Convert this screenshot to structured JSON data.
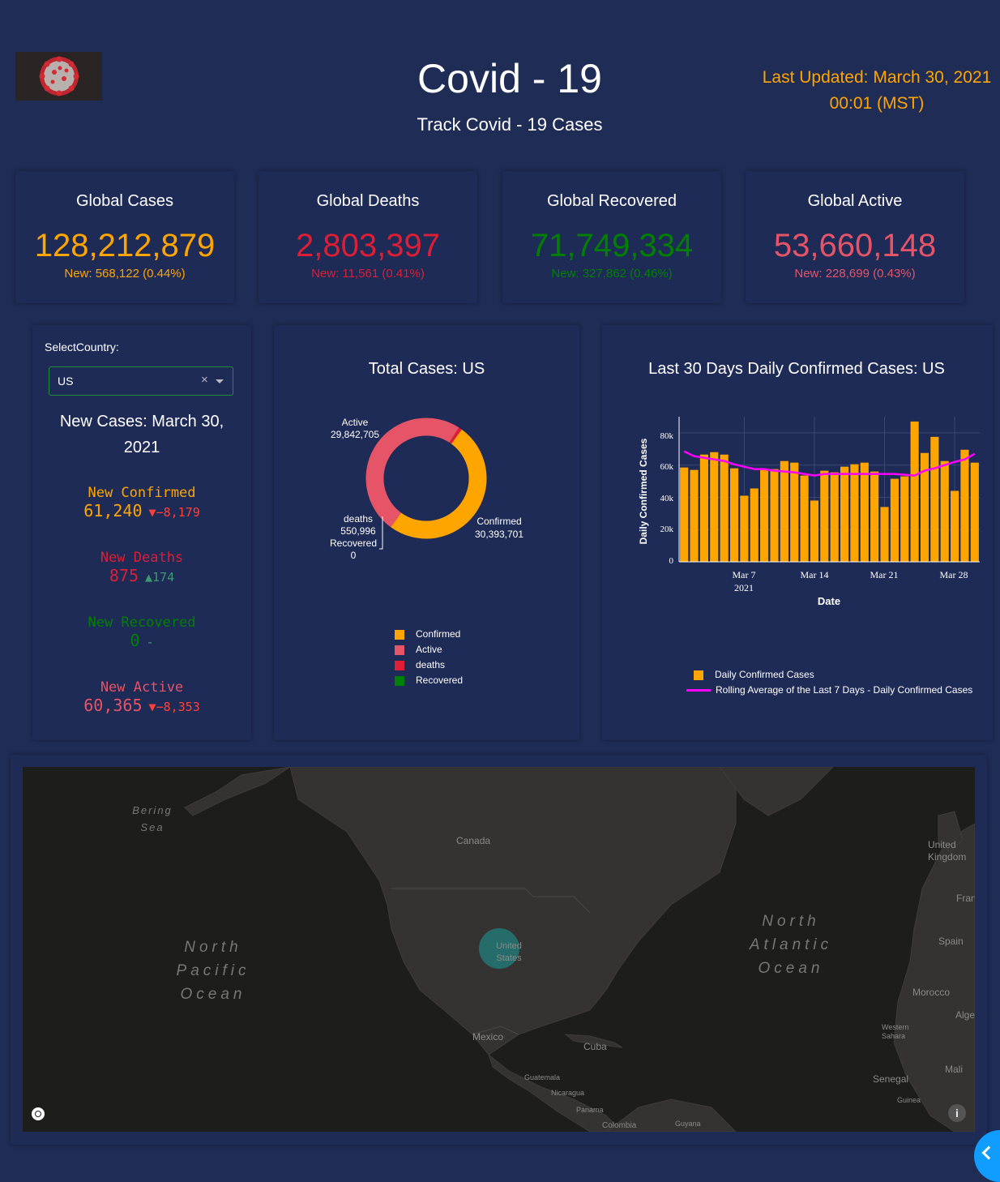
{
  "header": {
    "title": "Covid - 19",
    "subtitle": "Track Covid - 19 Cases",
    "last_updated_line1": "Last Updated: March 30, 2021",
    "last_updated_line2": "00:01 (MST)",
    "logo_icon": "coronavirus-logo-icon"
  },
  "kpis": [
    {
      "title": "Global Cases",
      "value": "128,212,879",
      "new": "New: 568,122 (0.44%)",
      "color": "#ffa500"
    },
    {
      "title": "Global Deaths",
      "value": "2,803,397",
      "new": "New: 11,561 (0.41%)",
      "color": "#dd1e35"
    },
    {
      "title": "Global Recovered",
      "value": "71,749,334",
      "new": "New: 327,862 (0.46%)",
      "color": "#008000"
    },
    {
      "title": "Global Active",
      "value": "53,660,148",
      "new": "New: 228,699 (0.43%)",
      "color": "#e55467"
    }
  ],
  "selector": {
    "label": "SelectCountry:",
    "value": "US",
    "clear_icon": "clear-icon",
    "dropdown_icon": "chevron-down-icon",
    "new_cases_title": "New Cases: March 30, 2021"
  },
  "indicators": [
    {
      "label": "New Confirmed",
      "value": "61,240",
      "delta": "▼−8,179",
      "color": "#ffa500",
      "delta_color": "#ff4136"
    },
    {
      "label": "New Deaths",
      "value": "875",
      "delta": "▲174",
      "color": "#dd1e35",
      "delta_color": "#3d9970"
    },
    {
      "label": "New Recovered",
      "value": "0",
      "delta": "-",
      "color": "#008000",
      "delta_color": "#3d9970"
    },
    {
      "label": "New Active",
      "value": "60,365",
      "delta": "▼−8,353",
      "color": "#e55467",
      "delta_color": "#ff4136"
    }
  ],
  "donut": {
    "title": "Total Cases: US",
    "labels": {
      "active_name": "Active",
      "active_value": "29,842,705",
      "confirmed_name": "Confirmed",
      "confirmed_value": "30,393,701",
      "deaths_name": "deaths",
      "deaths_value": "550,996",
      "recovered_name": "Recovered",
      "recovered_value": "0"
    },
    "legend": [
      "Confirmed",
      "Active",
      "deaths",
      "Recovered"
    ]
  },
  "bar": {
    "title": "Last 30 Days Daily Confirmed Cases: US",
    "ylabel": "Daily Confirmed Cases",
    "xlabel": "Date",
    "yticks": [
      "0",
      "20k",
      "40k",
      "60k",
      "80k"
    ],
    "xticks": [
      "Mar 7",
      "Mar 14",
      "Mar 21",
      "Mar 28"
    ],
    "xtick_year": "2021",
    "legend": [
      "Daily Confirmed Cases",
      "Rolling Average of the Last 7 Days - Daily Confirmed Cases"
    ]
  },
  "chart_data": [
    {
      "type": "pie",
      "title": "Total Cases: US",
      "labels": [
        "Confirmed",
        "Active",
        "deaths",
        "Recovered"
      ],
      "values": [
        30393701,
        29842705,
        550996,
        0
      ],
      "colors": [
        "#ffa500",
        "#e55467",
        "#dd1e35",
        "#008000"
      ],
      "hole": true
    },
    {
      "type": "bar",
      "title": "Last 30 Days Daily Confirmed Cases: US",
      "xlabel": "Date",
      "ylabel": "Daily Confirmed Cases",
      "ylim": [
        0,
        90000
      ],
      "x": [
        "2021-03-01",
        "2021-03-02",
        "2021-03-03",
        "2021-03-04",
        "2021-03-05",
        "2021-03-06",
        "2021-03-07",
        "2021-03-08",
        "2021-03-09",
        "2021-03-10",
        "2021-03-11",
        "2021-03-12",
        "2021-03-13",
        "2021-03-14",
        "2021-03-15",
        "2021-03-16",
        "2021-03-17",
        "2021-03-18",
        "2021-03-19",
        "2021-03-20",
        "2021-03-21",
        "2021-03-22",
        "2021-03-23",
        "2021-03-24",
        "2021-03-25",
        "2021-03-26",
        "2021-03-27",
        "2021-03-28",
        "2021-03-29",
        "2021-03-30"
      ],
      "series": [
        {
          "name": "Daily Confirmed Cases",
          "type": "bar",
          "color": "#ffa500",
          "values": [
            58500,
            57000,
            66500,
            68000,
            66500,
            58000,
            41000,
            45500,
            57500,
            57500,
            62500,
            61500,
            53500,
            38000,
            56500,
            55500,
            59000,
            60500,
            61500,
            56000,
            34000,
            51500,
            53000,
            87000,
            67500,
            77500,
            62500,
            44000,
            69500,
            61500
          ]
        },
        {
          "name": "Rolling Average of the Last 7 Days - Daily Confirmed Cases",
          "type": "line",
          "color": "#ff00ff",
          "values": [
            68500,
            65500,
            64500,
            63500,
            62500,
            60500,
            59000,
            57500,
            57500,
            56500,
            56000,
            55500,
            54500,
            53500,
            54500,
            54500,
            54500,
            54500,
            54500,
            54500,
            54500,
            54500,
            54000,
            53500,
            56500,
            58000,
            60000,
            62000,
            63500,
            67000
          ]
        }
      ]
    }
  ],
  "map": {
    "labels": {
      "bering": "Bering\nSea",
      "canada": "Canada",
      "npo": "North\nPacific\nOcean",
      "nao": "North\nAtlantic\nOcean",
      "us": "United\nStates",
      "mexico": "Mexico",
      "cuba": "Cuba",
      "guatemala": "Guatemala",
      "nicaragua": "Nicaragua",
      "panama": "Panama",
      "colombia": "Colombia",
      "guyana": "Guyana",
      "uk": "United\nKingdom",
      "fran": "Fran",
      "spain": "Spain",
      "morocco": "Morocco",
      "alge": "Alge",
      "wsahara": "Western\nSahara",
      "mali": "Mali",
      "senegal": "Senegal",
      "guinea": "Guinea"
    },
    "attribution_icon": "info-icon",
    "logo_icon": "mapbox-logo-icon"
  }
}
